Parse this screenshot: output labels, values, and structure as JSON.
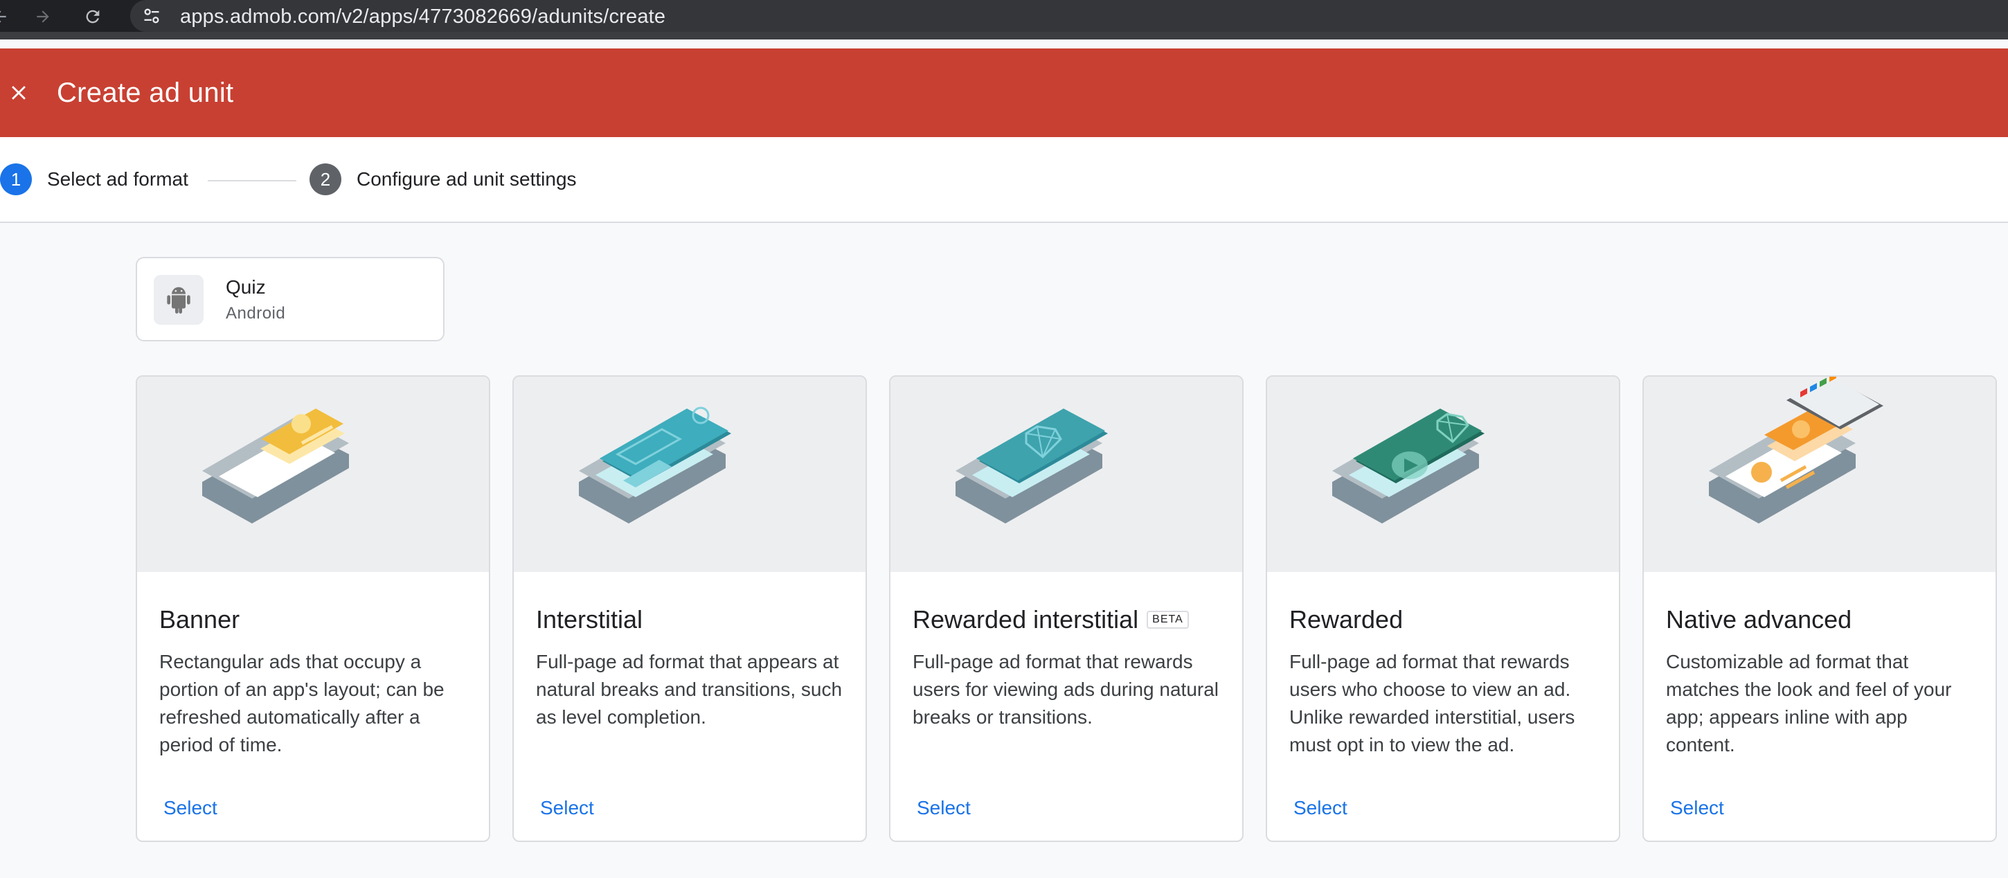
{
  "browser": {
    "url": "apps.admob.com/v2/apps/4773082669/adunits/create"
  },
  "header": {
    "title": "Create ad unit"
  },
  "stepper": {
    "steps": [
      {
        "number": "1",
        "label": "Select ad format"
      },
      {
        "number": "2",
        "label": "Configure ad unit settings"
      }
    ]
  },
  "app": {
    "name": "Quiz",
    "platform": "Android"
  },
  "formats": [
    {
      "title": "Banner",
      "badge": "",
      "description": "Rectangular ads that occupy a portion of an app's layout; can be refreshed automatically after a period of time.",
      "select_label": "Select"
    },
    {
      "title": "Interstitial",
      "badge": "",
      "description": "Full-page ad format that appears at natural breaks and transitions, such as level completion.",
      "select_label": "Select"
    },
    {
      "title": "Rewarded interstitial",
      "badge": "BETA",
      "description": "Full-page ad format that rewards users for viewing ads during natural breaks or transitions.",
      "select_label": "Select"
    },
    {
      "title": "Rewarded",
      "badge": "",
      "description": "Full-page ad format that rewards users who choose to view an ad. Unlike rewarded interstitial, users must opt in to view the ad.",
      "select_label": "Select"
    },
    {
      "title": "Native advanced",
      "badge": "",
      "description": "Customizable ad format that matches the look and feel of your app; appears inline with app content.",
      "select_label": "Select"
    }
  ],
  "colors": {
    "header_red": "#c84032",
    "active_step": "#1a73e8",
    "inactive_step": "#5f6368",
    "link_blue": "#1a73e8"
  },
  "icons": {
    "back": "arrow-left-icon",
    "forward": "arrow-right-icon",
    "reload": "reload-icon",
    "site_info": "tune-icon",
    "close": "close-icon",
    "app": "android-icon"
  }
}
